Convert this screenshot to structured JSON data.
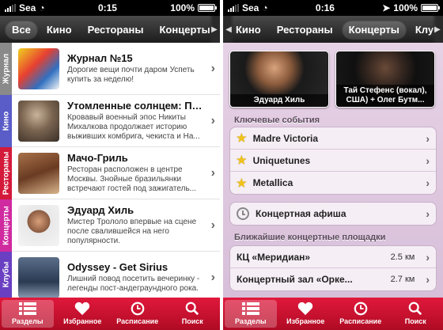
{
  "left": {
    "status": {
      "carrier": "Sea",
      "time": "0:15",
      "battery": "100%"
    },
    "tabs": [
      "Все",
      "Кино",
      "Рестораны",
      "Концерты"
    ],
    "sidebar": [
      "Журнал",
      "Кино",
      "Рестораны",
      "Концерты",
      "Клубы"
    ],
    "items": [
      {
        "title": "Журнал №15",
        "desc": "Дорогие вещи почти даром Успеть купить за неделю!"
      },
      {
        "title": "Утомленные солнцем: Пр...",
        "desc": "Кровавый военный эпос Никиты Михалкова продолжает историю выживших комбрига, чекиста и На..."
      },
      {
        "title": "Мачо-Гриль",
        "desc": "Ресторан расположен в центре Москвы. Знойные бразильянки встречают гостей под зажигатель..."
      },
      {
        "title": "Эдуард Хиль",
        "desc": "Мистер Трололо впервые на сцене после свалившейся на него популярности."
      },
      {
        "title": "Odyssey - Get Sirius",
        "desc": "Лишний повод посетить вечеринку - легенды пост-андеграундного рока."
      }
    ],
    "bottom_nav": [
      "Разделы",
      "Избранное",
      "Расписание",
      "Поиск"
    ]
  },
  "right": {
    "status": {
      "carrier": "Sea",
      "time": "0:16",
      "battery": "100%"
    },
    "tabs": [
      "Кино",
      "Рестораны",
      "Концерты",
      "Клубы"
    ],
    "featured": [
      "Эдуард Хиль",
      "Тай Стефенс (вокал), США) + Олег Бутм..."
    ],
    "key_events_title": "Ключевые события",
    "key_events": [
      "Madre Victoria",
      "Uniquetunes",
      "Metallica"
    ],
    "poster": "Концертная афиша",
    "venues_title": "Ближайшие концертные площадки",
    "venues": [
      {
        "name": "КЦ «Меридиан»",
        "distance": "2.5 км"
      },
      {
        "name": "Концертный зал «Орке...",
        "distance": "2.7 км"
      }
    ],
    "bottom_nav": [
      "Разделы",
      "Избранное",
      "Расписание",
      "Поиск"
    ]
  },
  "colors": {
    "accent": "#d4112f",
    "sidebar": [
      "#8a8a8a",
      "#5a5cc8",
      "#d41a3a",
      "#d02aa0",
      "#6a3fc2"
    ]
  },
  "icons": {
    "nav": [
      "list-icon",
      "heart-icon",
      "clock-icon",
      "search-icon"
    ],
    "event": "star-icon",
    "poster": "clock-icon"
  }
}
